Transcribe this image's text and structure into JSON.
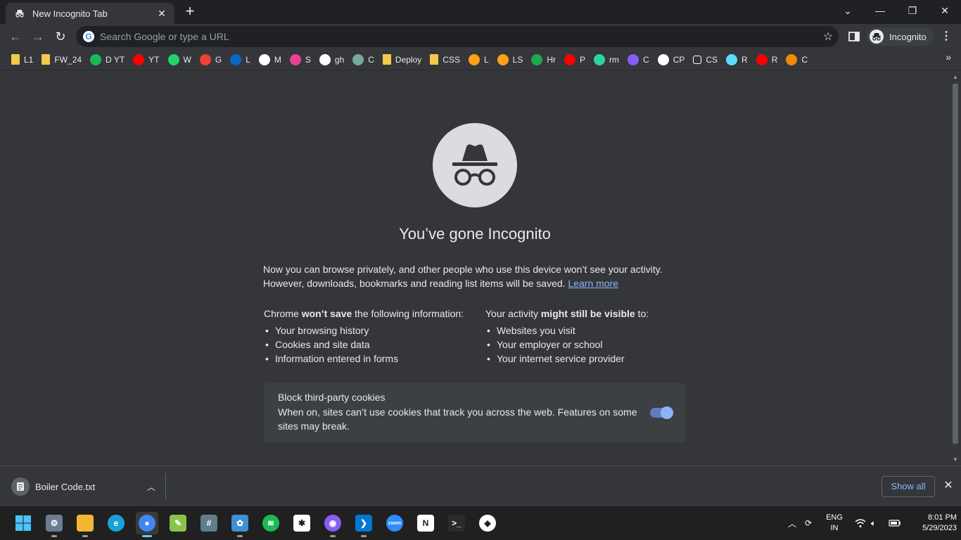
{
  "tab": {
    "title": "New Incognito Tab"
  },
  "omnibox": {
    "placeholder": "Search Google or type a URL"
  },
  "profile": {
    "label": "Incognito"
  },
  "bookmarks": [
    {
      "label": "L1",
      "icon": "folder-icon",
      "color": "#f2c94c"
    },
    {
      "label": "FW_24",
      "icon": "folder-icon",
      "color": "#f2c94c"
    },
    {
      "label": "D YT",
      "icon": "play-icon",
      "color": "#1db954"
    },
    {
      "label": "YT",
      "icon": "youtube-icon",
      "color": "#ff0000"
    },
    {
      "label": "W",
      "icon": "whatsapp-icon",
      "color": "#25d366"
    },
    {
      "label": "G",
      "icon": "gmail-icon",
      "color": "#ea4335"
    },
    {
      "label": "L",
      "icon": "linkedin-icon",
      "color": "#0a66c2"
    },
    {
      "label": "M",
      "icon": "medium-icon",
      "color": "#ffffff"
    },
    {
      "label": "S",
      "icon": "swirl-icon",
      "color": "#e84393"
    },
    {
      "label": "gh",
      "icon": "github-icon",
      "color": "#ffffff"
    },
    {
      "label": "C",
      "icon": "chatgpt-icon",
      "color": "#74aa9c"
    },
    {
      "label": "Deploy",
      "icon": "folder-icon",
      "color": "#f2c94c"
    },
    {
      "label": "CSS",
      "icon": "folder-icon",
      "color": "#f2c94c"
    },
    {
      "label": "L",
      "icon": "leetcode-icon",
      "color": "#ffa116"
    },
    {
      "label": "LS",
      "icon": "leetcode-icon",
      "color": "#ffa116"
    },
    {
      "label": "Hr",
      "icon": "hackerrank-icon",
      "color": "#1ba94c"
    },
    {
      "label": "P",
      "icon": "youtube-icon",
      "color": "#ff0000"
    },
    {
      "label": "rm",
      "icon": "rm-icon",
      "color": "#2bd4a0"
    },
    {
      "label": "C",
      "icon": "wand-icon",
      "color": "#8a5cf6"
    },
    {
      "label": "CP",
      "icon": "codepen-icon",
      "color": "#ffffff"
    },
    {
      "label": "CS",
      "icon": "square-icon",
      "color": "#ffffff"
    },
    {
      "label": "R",
      "icon": "react-icon",
      "color": "#61dafb"
    },
    {
      "label": "R",
      "icon": "youtube-icon",
      "color": "#ff0000"
    },
    {
      "label": "C",
      "icon": "c-icon",
      "color": "#f28b00"
    }
  ],
  "incognito": {
    "headline": "You’ve gone Incognito",
    "intro_text": "Now you can browse privately, and other people who use this device won’t see your activity. However, downloads, bookmarks and reading list items will be saved.",
    "learn_more": "Learn more",
    "left_heading_pre": "Chrome ",
    "left_heading_bold": "won’t save",
    "left_heading_post": " the following information:",
    "left_items": [
      "Your browsing history",
      "Cookies and site data",
      "Information entered in forms"
    ],
    "right_heading_pre": "Your activity ",
    "right_heading_bold": "might still be visible",
    "right_heading_post": " to:",
    "right_items": [
      "Websites you visit",
      "Your employer or school",
      "Your internet service provider"
    ],
    "cookie_title": "Block third-party cookies",
    "cookie_desc": "When on, sites can’t use cookies that track you across the web. Features on some sites may break.",
    "cookie_toggle_on": true
  },
  "download": {
    "filename": "Boiler Code.txt",
    "show_all": "Show all"
  },
  "taskbar": {
    "apps": [
      {
        "name": "settings",
        "color": "#6b7c93",
        "glyph": "⚙"
      },
      {
        "name": "file-explorer",
        "color": "#f2b632",
        "glyph": ""
      },
      {
        "name": "edge",
        "color": "#1aa0d8",
        "glyph": "e"
      },
      {
        "name": "chrome",
        "color": "#4285f4",
        "glyph": "●"
      },
      {
        "name": "notepad",
        "color": "#8bc34a",
        "glyph": "✎"
      },
      {
        "name": "calculator",
        "color": "#607d8b",
        "glyph": "#"
      },
      {
        "name": "paint",
        "color": "#3d8fd6",
        "glyph": "✿"
      },
      {
        "name": "spotify",
        "color": "#1db954",
        "glyph": "≋"
      },
      {
        "name": "slack",
        "color": "#ffffff",
        "glyph": "✱"
      },
      {
        "name": "github-desktop",
        "color": "#8a5cf6",
        "glyph": "◉"
      },
      {
        "name": "vscode",
        "color": "#0078d4",
        "glyph": "❯"
      },
      {
        "name": "zoom",
        "color": "#2d8cff",
        "glyph": "zoom"
      },
      {
        "name": "notion",
        "color": "#ffffff",
        "glyph": "N"
      },
      {
        "name": "terminal",
        "color": "#2b2b2b",
        "glyph": ">_"
      },
      {
        "name": "mongodb-compass",
        "color": "#ffffff",
        "glyph": "◆"
      }
    ],
    "language_line1": "ENG",
    "language_line2": "IN",
    "time": "8:01 PM",
    "date": "5/29/2023"
  }
}
